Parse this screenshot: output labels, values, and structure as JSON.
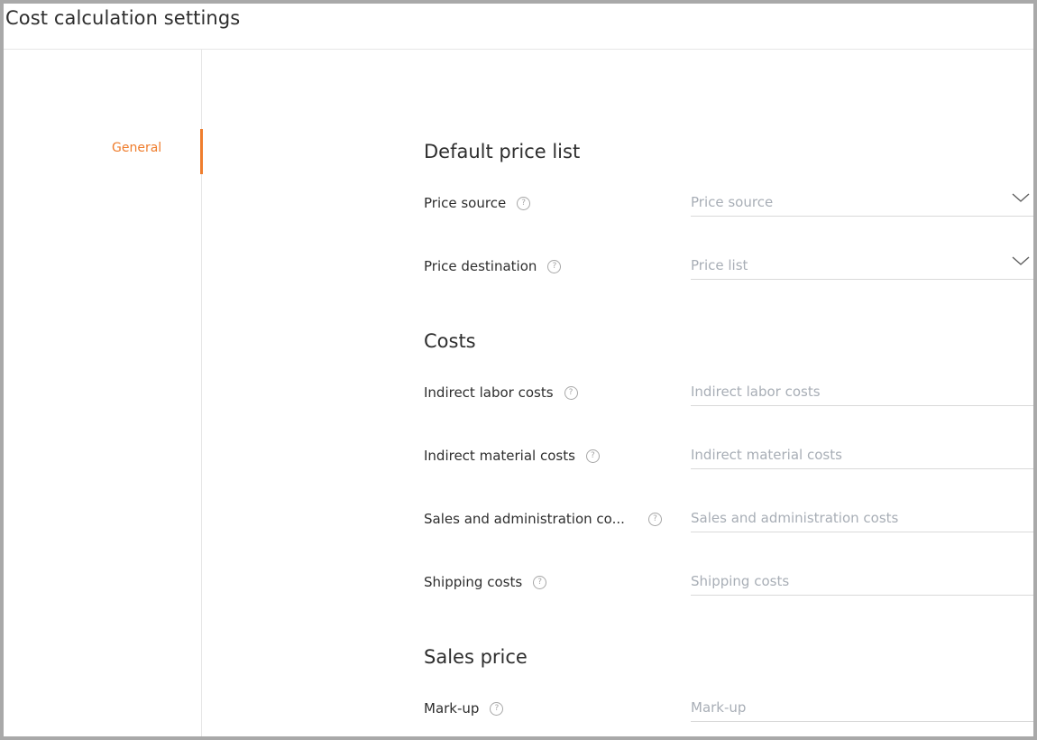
{
  "window": {
    "title": "Cost calculation settings"
  },
  "nav": {
    "items": [
      {
        "label": "General"
      }
    ]
  },
  "sections": {
    "default_price_list": {
      "title": "Default price list",
      "price_source": {
        "label": "Price source",
        "placeholder": "Price source",
        "icon": "help-icon"
      },
      "price_destination": {
        "label": "Price destination",
        "placeholder": "Price list",
        "icon": "help-icon"
      }
    },
    "costs": {
      "title": "Costs",
      "indirect_labor": {
        "label": "Indirect labor costs",
        "placeholder": "Indirect labor costs"
      },
      "indirect_material": {
        "label": "Indirect material costs",
        "placeholder": "Indirect material costs"
      },
      "sales_admin": {
        "label": "Sales and administration co...",
        "placeholder": "Sales and administration costs"
      },
      "shipping": {
        "label": "Shipping costs",
        "placeholder": "Shipping costs"
      }
    },
    "sales_price": {
      "title": "Sales price",
      "markup": {
        "label": "Mark-up",
        "placeholder": "Mark-up"
      }
    }
  },
  "help_glyph": "?",
  "colors": {
    "accent": "#ef7d2d",
    "text": "#2e2e2e",
    "placeholder": "#a8aeb6",
    "rule": "#d9d9d9"
  }
}
